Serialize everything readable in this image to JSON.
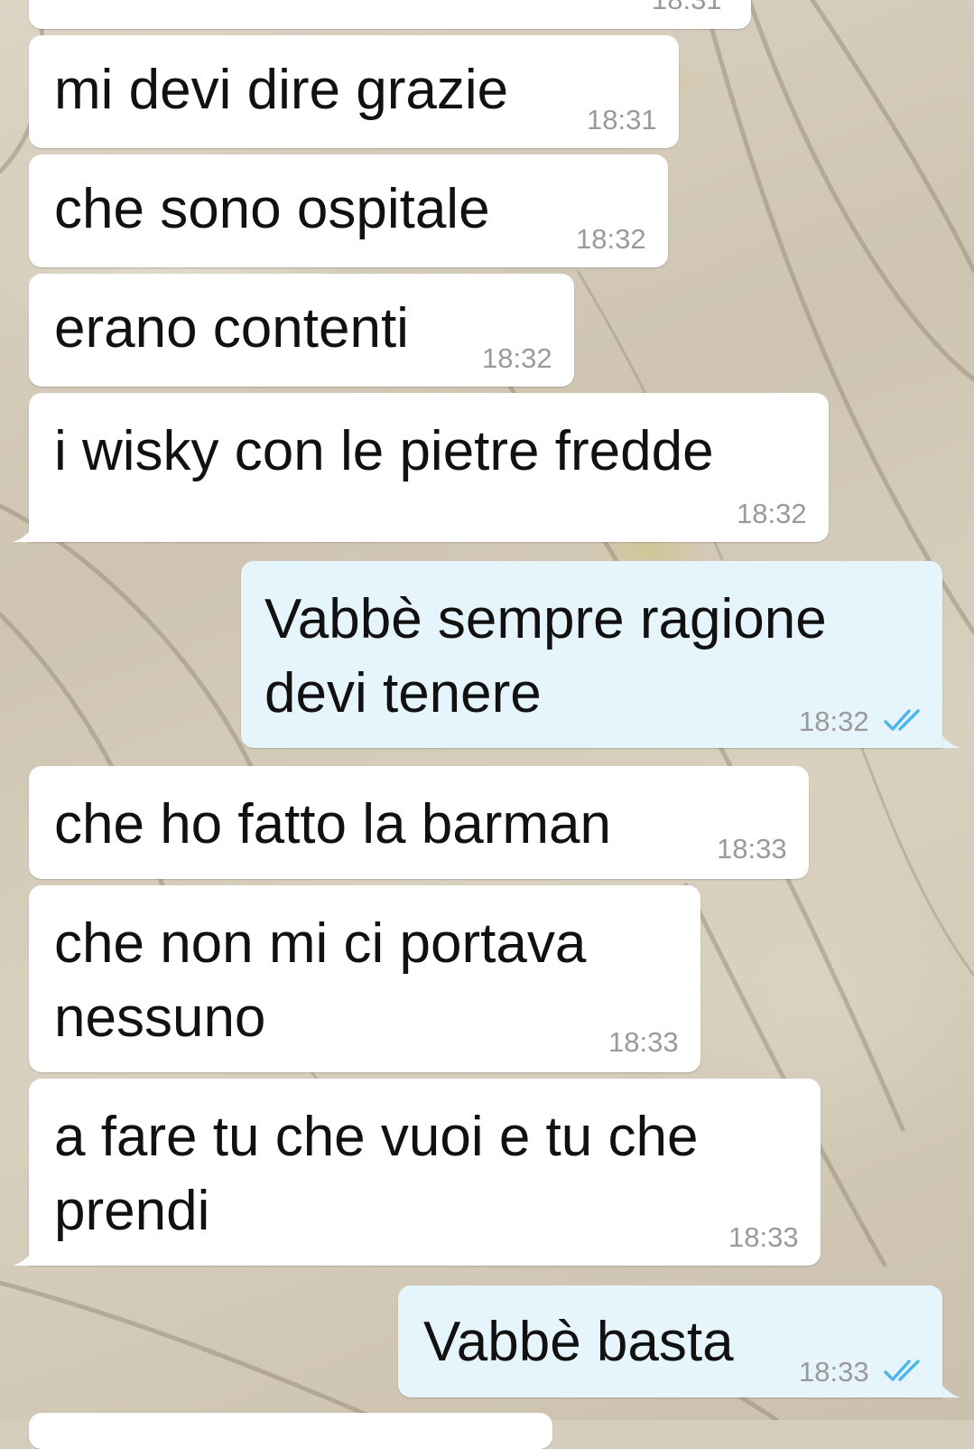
{
  "chat": {
    "partial_top_time": "18:31",
    "messages": [
      {
        "direction": "in",
        "text": "mi devi dire grazie",
        "time": "18:31"
      },
      {
        "direction": "in",
        "text": "che sono ospitale",
        "time": "18:32"
      },
      {
        "direction": "in",
        "text": "erano contenti",
        "time": "18:32"
      },
      {
        "direction": "in",
        "text": "i wisky con le pietre fredde",
        "time": "18:32"
      },
      {
        "direction": "out",
        "lines": [
          "Vabbè sempre ragione",
          "devi tenere"
        ],
        "time": "18:32",
        "status_icon": "double-check-read-icon"
      },
      {
        "direction": "in",
        "text": "che ho fatto la barman",
        "time": "18:33"
      },
      {
        "direction": "in",
        "lines": [
          "che non mi ci portava",
          "nessuno"
        ],
        "time": "18:33"
      },
      {
        "direction": "in",
        "lines": [
          "a fare tu che vuoi e tu che",
          "prendi"
        ],
        "time": "18:33"
      },
      {
        "direction": "out",
        "text": "Vabbè basta",
        "time": "18:33",
        "status_icon": "double-check-read-icon"
      }
    ]
  },
  "colors": {
    "incoming_bubble": "#ffffff",
    "outgoing_bubble": "#e6f4fb",
    "timestamp": "#9a9a9a",
    "read_ticks": "#4fb6ec"
  }
}
